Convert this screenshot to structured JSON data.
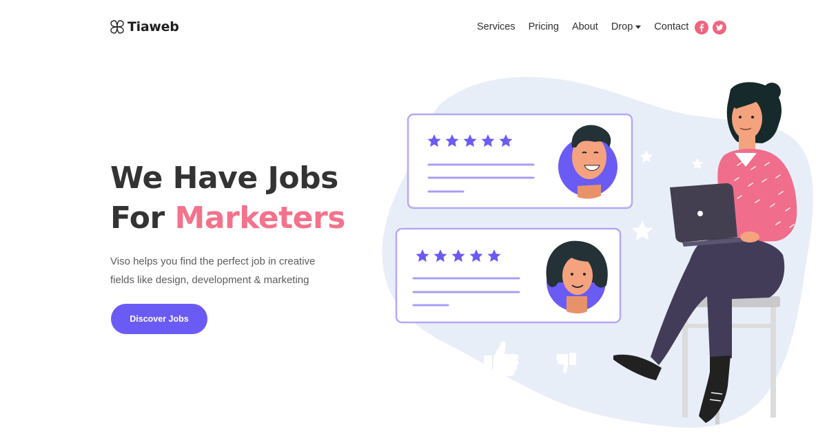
{
  "brand": {
    "name": "Tiaweb",
    "logo_icon": "flower-logo-icon"
  },
  "nav": {
    "items": [
      {
        "label": "Services"
      },
      {
        "label": "Pricing"
      },
      {
        "label": "About"
      },
      {
        "label": "Drop",
        "has_dropdown": true
      },
      {
        "label": "Contact"
      }
    ],
    "socials": [
      {
        "icon": "facebook-icon"
      },
      {
        "icon": "twitter-icon"
      }
    ]
  },
  "hero": {
    "title_line1": "We Have Jobs",
    "title_line2_prefix": "For ",
    "title_line2_accent": "Marketers",
    "description": "Viso helps you find the perfect job in creative fields like design, development & marketing",
    "cta_label": "Discover Jobs"
  },
  "illustration": {
    "review_cards": [
      {
        "stars": 5,
        "avatar": "man-avatar-icon"
      },
      {
        "stars": 5,
        "avatar": "woman-avatar-icon"
      }
    ],
    "icons": [
      "star-icon",
      "thumbs-up-icon",
      "thumbs-down-icon",
      "laptop-icon"
    ]
  },
  "colors": {
    "accent_pink": "#f4728b",
    "primary_purple": "#6b5bf5",
    "blob_blue": "#e6eef8",
    "card_border": "#b3a8f7",
    "text_dark": "#333333"
  }
}
